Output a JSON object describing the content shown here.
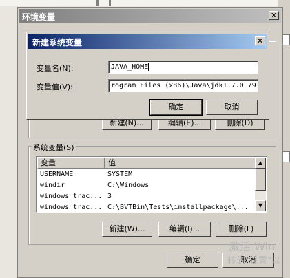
{
  "outer": {
    "title": "环境变量",
    "system_vars_label": "系统变量(S)",
    "columns": [
      "变量",
      "值"
    ],
    "rows": [
      {
        "name": "USERNAME",
        "value": "SYSTEM"
      },
      {
        "name": "windir",
        "value": "C:\\Windows"
      },
      {
        "name": "windows_trac...",
        "value": "3"
      },
      {
        "name": "windows_trac...",
        "value": "C:\\BVTBin\\Tests\\installpackage\\..."
      }
    ],
    "buttons": {
      "new": "新建(W)...",
      "edit": "编辑(I)...",
      "delete": "删除(L)",
      "ok": "确定",
      "cancel": "取消"
    },
    "partial_user_buttons": [
      "新建(N)...",
      "编辑(E)...",
      "删除(D)"
    ]
  },
  "dialog": {
    "title": "新建系统变量",
    "name_label": "变量名(N):",
    "value_label": "变量值(V):",
    "name_value": "JAVA_HOME",
    "value_value": "rogram Files (x86)\\Java\\jdk1.7.0_79",
    "ok": "确定",
    "cancel": "取消",
    "close_glyph": "✕"
  },
  "scroll": {
    "up": "▲",
    "down": "▼"
  },
  "watermark": {
    "line1": "激活 Win",
    "line2": "转到\"设置\"以"
  }
}
